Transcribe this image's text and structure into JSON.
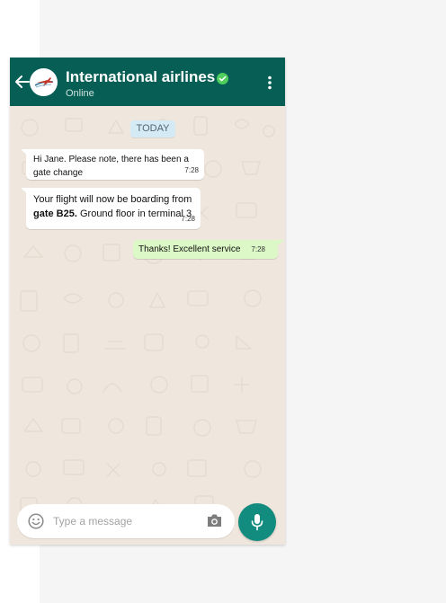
{
  "header": {
    "contact_name": "International airlines",
    "status": "Online"
  },
  "chat": {
    "date_label": "TODAY",
    "messages": [
      {
        "direction": "incoming",
        "line1": "Hi Jane. Please note, there has been a",
        "line2": "gate change",
        "time": "7:28"
      },
      {
        "direction": "incoming",
        "line1": "Your flight will now be boarding from",
        "bold": "gate B25.",
        "rest": " Ground floor in terminal 3",
        "time": "7:28"
      },
      {
        "direction": "outgoing",
        "text": "Thanks! Excellent service",
        "time": "7:28"
      }
    ]
  },
  "composer": {
    "placeholder": "Type a message"
  },
  "icons": {
    "back": "arrow-left-icon",
    "avatar": "airline-logo",
    "verified": "check-badge-icon",
    "menu": "kebab-menu-icon",
    "emoji": "smiley-icon",
    "camera": "camera-icon",
    "mic": "microphone-icon"
  },
  "colors": {
    "header": "#075e54",
    "chat_background": "#efe7dd",
    "outgoing_bubble": "#dcf8c6",
    "incoming_bubble": "#ffffff",
    "verified": "#4fce5d",
    "mic_button": "#128c7e",
    "date_chip": "#d4eaf4"
  }
}
